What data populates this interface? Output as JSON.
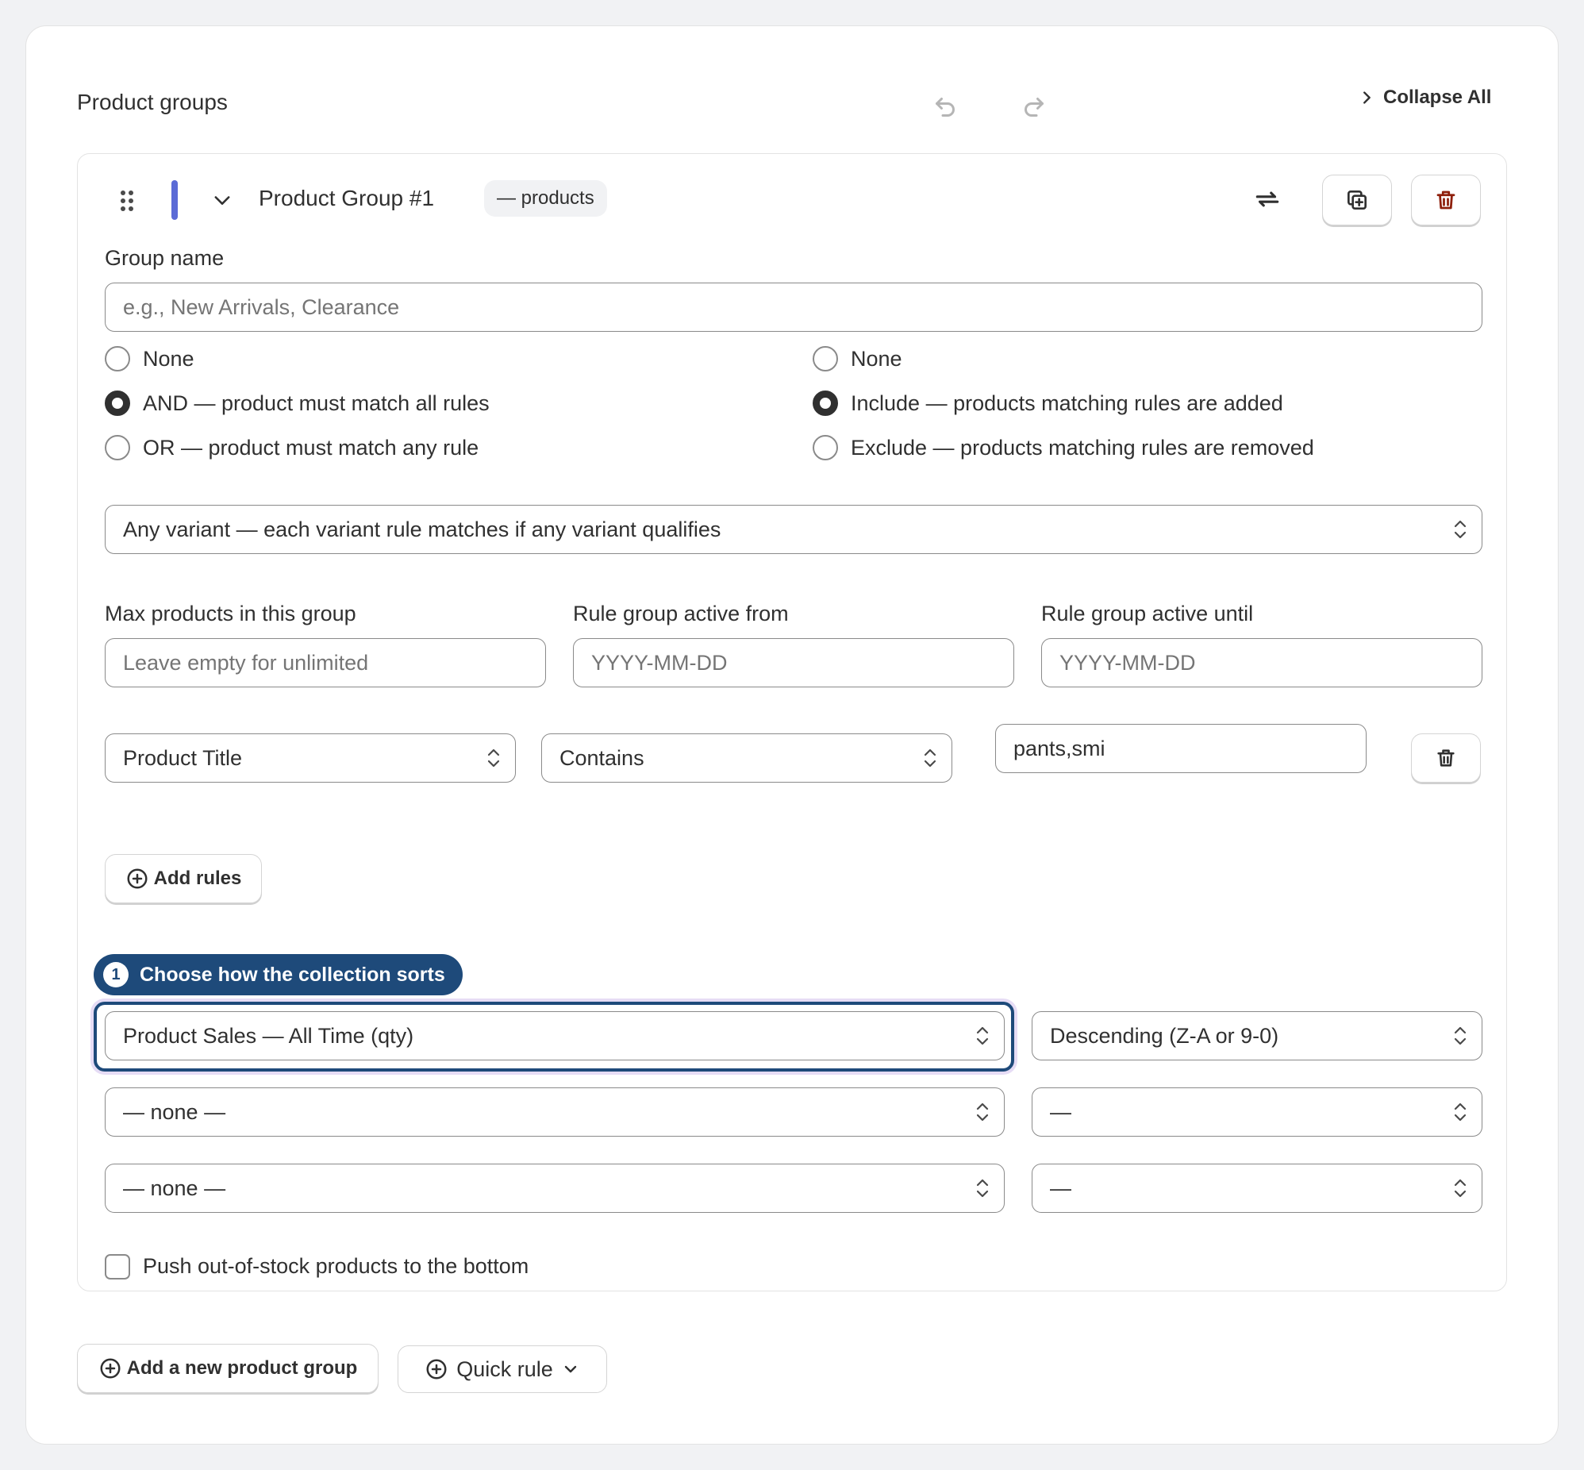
{
  "header": {
    "title": "Product groups",
    "undo_icon": "undo-icon",
    "redo_icon": "redo-icon",
    "collapse_label": "Collapse All"
  },
  "group": {
    "title": "Product Group #1",
    "count_badge": "— products",
    "accent_color": "#5b6bd6",
    "name_label": "Group name",
    "name_placeholder": "e.g., New Arrivals, Clearance",
    "match_options": [
      {
        "label": "None",
        "selected": false
      },
      {
        "label": "AND — product must match all rules",
        "selected": true
      },
      {
        "label": "OR — product must match any rule",
        "selected": false
      }
    ],
    "mode_options": [
      {
        "label": "None",
        "selected": false
      },
      {
        "label": "Include — products matching rules are added",
        "selected": true
      },
      {
        "label": "Exclude — products matching rules are removed",
        "selected": false
      }
    ],
    "variant_select": "Any variant — each variant rule matches if any variant qualifies",
    "max_label": "Max products in this group",
    "max_placeholder": "Leave empty for unlimited",
    "from_label": "Rule group active from",
    "from_placeholder": "YYYY-MM-DD",
    "until_label": "Rule group active until",
    "until_placeholder": "YYYY-MM-DD",
    "rule": {
      "field": "Product Title",
      "operator": "Contains",
      "value": "pants,smi"
    },
    "add_rules_label": "Add rules",
    "sort_tip": {
      "number": "1",
      "text": "Choose how the collection sorts"
    },
    "sorts": [
      {
        "field": "Product Sales — All Time (qty)",
        "direction": "Descending (Z-A or 9-0)"
      },
      {
        "field": "— none —",
        "direction": "—"
      },
      {
        "field": "— none —",
        "direction": "—"
      }
    ],
    "push_oos_label": "Push out-of-stock products to the bottom",
    "push_oos_checked": false
  },
  "footer": {
    "add_group_label": "Add a new product group",
    "quick_rule_label": "Quick rule"
  },
  "colors": {
    "tip_bg": "#1e4a7a",
    "danger": "#8e1f0b"
  }
}
